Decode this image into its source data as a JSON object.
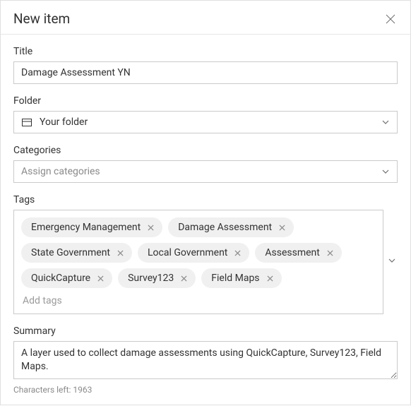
{
  "header": {
    "title": "New item"
  },
  "title": {
    "label": "Title",
    "value": "Damage Assessment YN"
  },
  "folder": {
    "label": "Folder",
    "value": "Your folder"
  },
  "categories": {
    "label": "Categories",
    "placeholder": "Assign categories"
  },
  "tags": {
    "label": "Tags",
    "add_placeholder": "Add tags",
    "items": [
      "Emergency Management",
      "Damage Assessment",
      "State Government",
      "Local Government",
      "Assessment",
      "QuickCapture",
      "Survey123",
      "Field Maps"
    ]
  },
  "summary": {
    "label": "Summary",
    "value": "A layer used to collect damage assessments using QuickCapture, Survey123, Field Maps.",
    "chars_left": "Characters left: 1963"
  }
}
